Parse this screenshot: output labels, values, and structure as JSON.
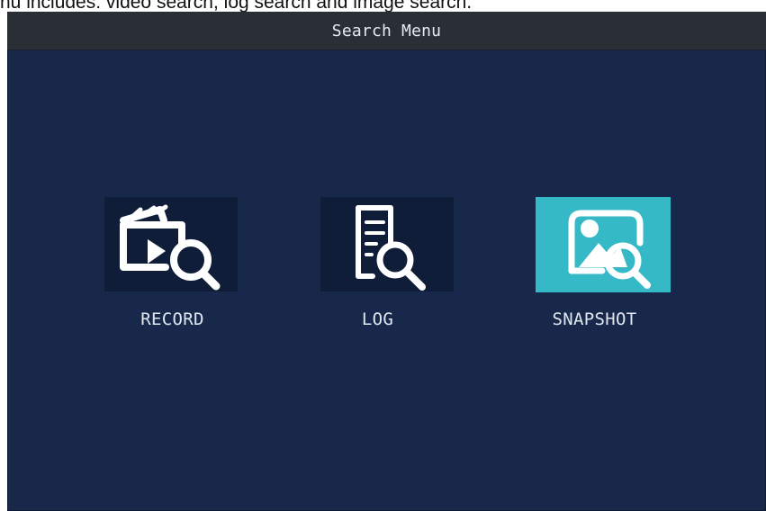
{
  "caption": "nu includes: video search, log search and image search.",
  "window": {
    "title": "Search Menu"
  },
  "menu": {
    "items": [
      {
        "label": "RECORD",
        "icon": "video-search-icon",
        "selected": false
      },
      {
        "label": "LOG",
        "icon": "log-search-icon",
        "selected": false
      },
      {
        "label": "SNAPSHOT",
        "icon": "image-search-icon",
        "selected": true
      }
    ]
  },
  "colors": {
    "screen": "#17284b",
    "title_bar": "#2a2e35",
    "tile": "#0f1d38",
    "selected_tile": "#35b9c6",
    "icon": "#ffffff",
    "label": "#e1e7ef"
  }
}
